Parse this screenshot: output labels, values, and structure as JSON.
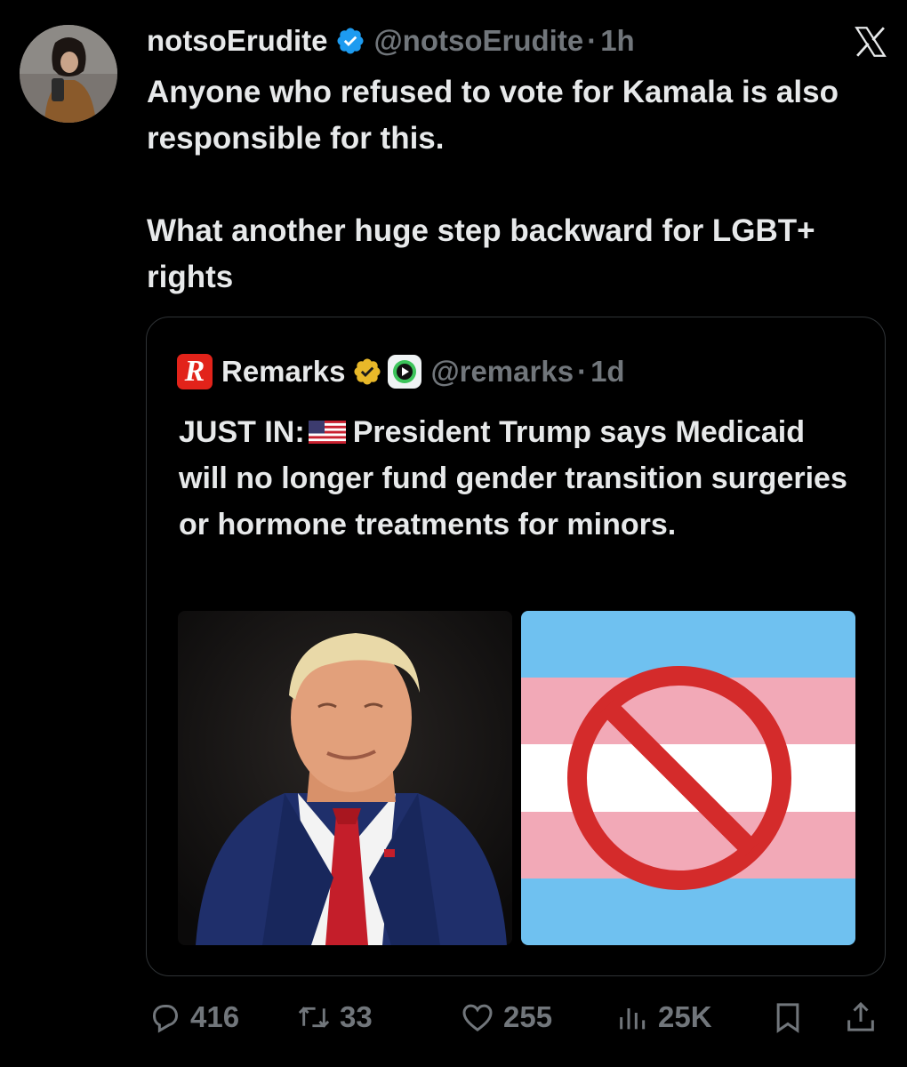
{
  "post": {
    "display_name": "notsoErudite",
    "handle": "@notsoErudite",
    "separator": "·",
    "time": "1h",
    "text_line1": "Anyone who refused to vote for Kamala is also responsible for this.",
    "text_line2": "What another huge step backward for LGBT+ rights"
  },
  "quote": {
    "logo_letter": "R",
    "display_name": "Remarks",
    "handle": "@remarks",
    "separator": "·",
    "time": "1d",
    "text_prefix": "JUST IN:",
    "text_body": "President Trump says Medicaid will no longer fund gender transition surgeries or hormone treatments for minors."
  },
  "actions": {
    "replies": "416",
    "reposts": "33",
    "likes": "255",
    "views": "25K"
  },
  "colors": {
    "background": "#000000",
    "text_primary": "#e7e9ea",
    "text_secondary": "#71767b",
    "verified_blue": "#1d9bf0",
    "verified_gold": "#e8b829",
    "trans_blue": "#6fc1f0",
    "trans_pink": "#f2a9b7",
    "prohibit_red": "#d42b2b"
  },
  "icons": {
    "verified": "verified-badge-icon",
    "x_logo": "x-logo-icon",
    "reply": "reply-icon",
    "repost": "repost-icon",
    "like": "heart-icon",
    "views": "views-icon",
    "bookmark": "bookmark-icon",
    "share": "share-icon"
  }
}
